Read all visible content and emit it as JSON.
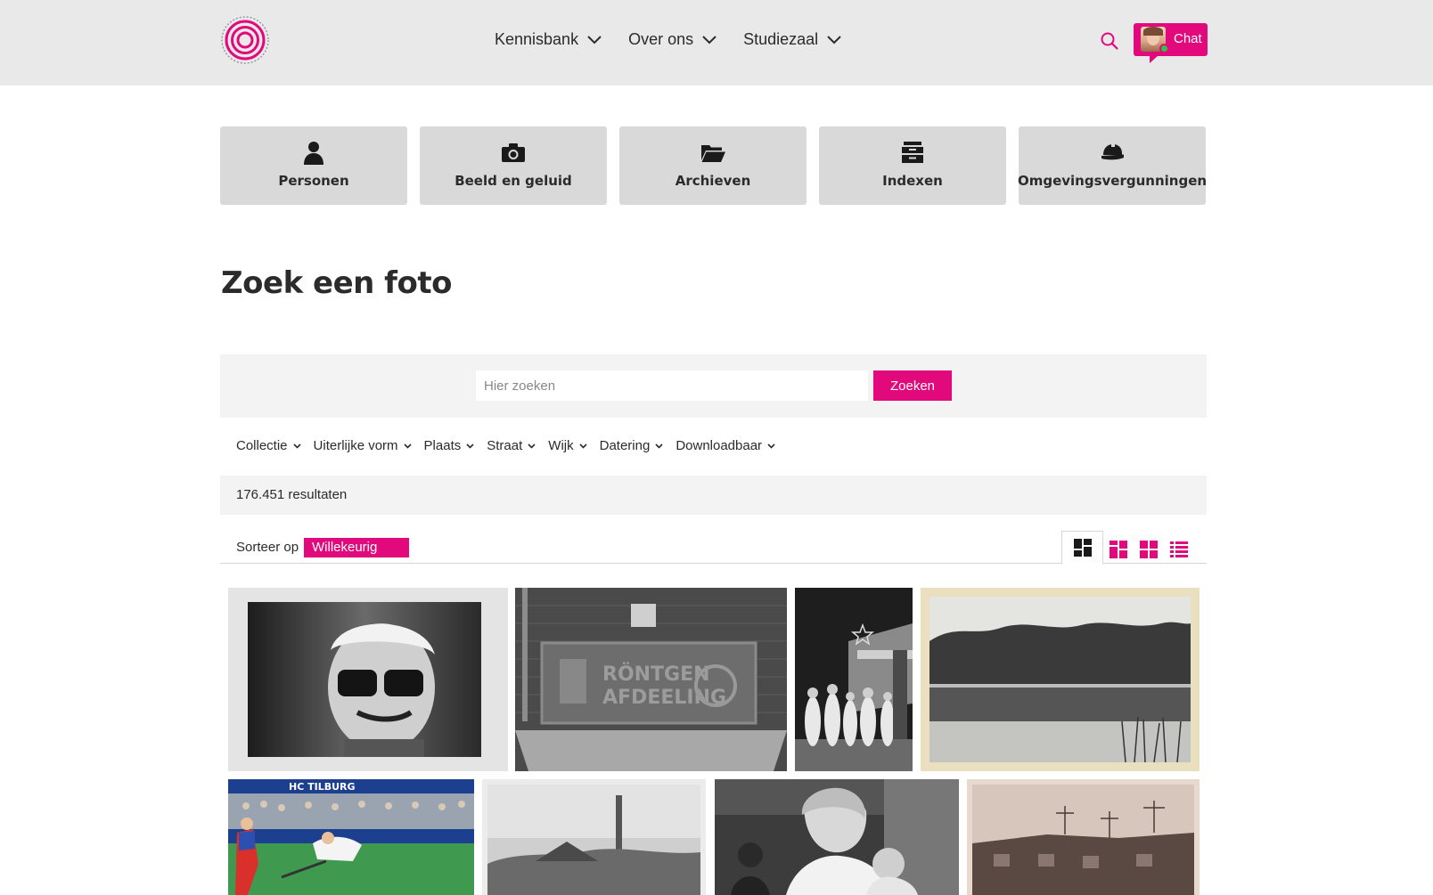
{
  "header": {
    "nav": [
      {
        "label": "Kennisbank"
      },
      {
        "label": "Over ons"
      },
      {
        "label": "Studiezaal"
      }
    ],
    "chat_label": "Chat"
  },
  "tiles": [
    {
      "label": "Personen",
      "icon": "person-icon"
    },
    {
      "label": "Beeld en geluid",
      "icon": "camera-icon"
    },
    {
      "label": "Archieven",
      "icon": "folder-open-icon"
    },
    {
      "label": "Indexen",
      "icon": "archive-box-icon"
    },
    {
      "label": "Omgevingsvergunningen",
      "icon": "hard-hat-icon"
    }
  ],
  "page_title": "Zoek een foto",
  "search": {
    "placeholder": "Hier zoeken",
    "button_label": "Zoeken"
  },
  "filters": [
    {
      "label": "Collectie"
    },
    {
      "label": "Uiterlijke vorm"
    },
    {
      "label": "Plaats"
    },
    {
      "label": "Straat"
    },
    {
      "label": "Wijk"
    },
    {
      "label": "Datering"
    },
    {
      "label": "Downloadbaar"
    }
  ],
  "results": {
    "text": "176.451 resultaten"
  },
  "sort": {
    "label": "Sorteer op",
    "selected": "Willekeurig"
  },
  "views": [
    {
      "name": "masonry-view-icon",
      "active": true
    },
    {
      "name": "large-grid-view-icon",
      "active": false
    },
    {
      "name": "small-grid-view-icon",
      "active": false
    },
    {
      "name": "list-view-icon",
      "active": false
    }
  ],
  "colors": {
    "accent": "#e2097d",
    "header_bg": "#e9e9e9",
    "tile_bg": "#d9d9d9",
    "band_bg": "#f3f3f3"
  }
}
